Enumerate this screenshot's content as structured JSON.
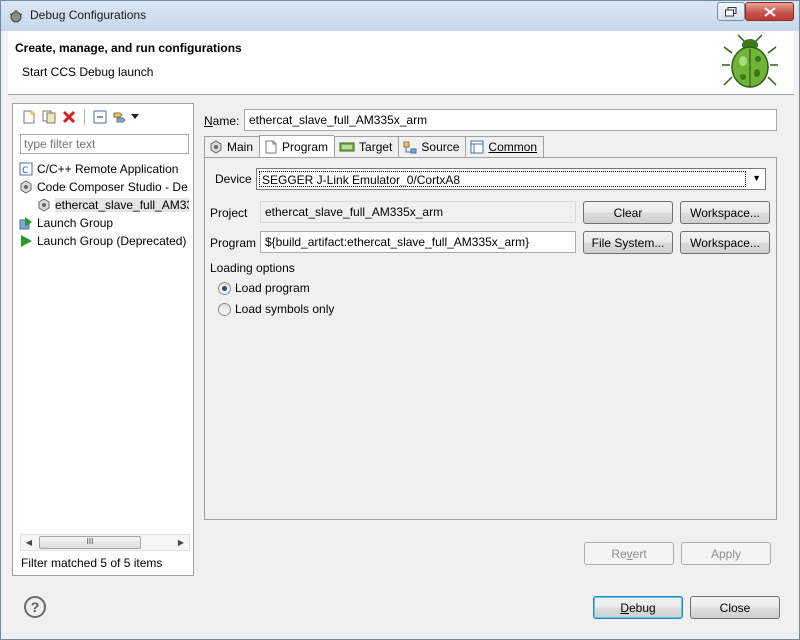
{
  "window": {
    "title": "Debug Configurations"
  },
  "header": {
    "title": "Create, manage, and run configurations",
    "subtitle": "Start CCS Debug launch"
  },
  "left_panel": {
    "filter_placeholder": "type filter text",
    "tree": [
      {
        "label": "C/C++ Remote Application",
        "icon": "c-remote-icon"
      },
      {
        "label": "Code Composer Studio - De",
        "icon": "ccs-icon"
      },
      {
        "label": "ethercat_slave_full_AM33",
        "icon": "ccs-config-icon",
        "child": true,
        "selected": true
      },
      {
        "label": "Launch Group",
        "icon": "launch-group-icon"
      },
      {
        "label": "Launch Group (Deprecated)",
        "icon": "launch-group-deprecated-icon"
      }
    ],
    "scroll_thumb": "III",
    "status": "Filter matched 5 of 5 items"
  },
  "config": {
    "name_label_u": "N",
    "name_label_rest": "ame:",
    "name_value": "ethercat_slave_full_AM335x_arm",
    "tabs": [
      {
        "label": "Main",
        "icon": "main-tab-icon"
      },
      {
        "label": "Program",
        "icon": "program-tab-icon",
        "active": true
      },
      {
        "label": "Target",
        "icon": "target-tab-icon"
      },
      {
        "label": "Source",
        "icon": "source-tab-icon"
      },
      {
        "label": "Common",
        "icon": "common-tab-icon"
      }
    ],
    "device_label": "Device",
    "device_value": "SEGGER J-Link Emulator_0/CortxA8",
    "project_label": "Project",
    "project_value": "ethercat_slave_full_AM335x_arm",
    "clear_label": "Clear",
    "workspace_label": "Workspace...",
    "program_label": "Program",
    "program_value": "${build_artifact:ethercat_slave_full_AM335x_arm}",
    "filesystem_label": "File System...",
    "workspace2_label": "Workspace...",
    "loading_options_label": "Loading options",
    "load_program_label": "Load program",
    "load_symbols_label": "Load symbols only",
    "revert_label_pre": "Re",
    "revert_label_u": "v",
    "revert_label_post": "ert",
    "apply_label": "Apply"
  },
  "footer": {
    "help_glyph": "?",
    "debug_label_u": "D",
    "debug_label_rest": "ebug",
    "close_label": "Close"
  }
}
